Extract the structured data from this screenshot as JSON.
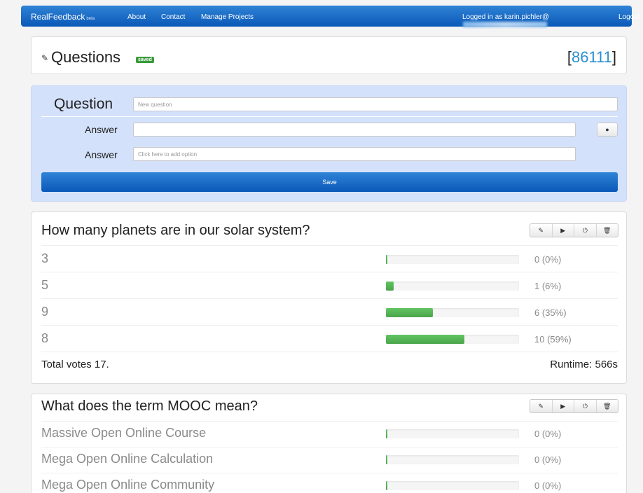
{
  "navbar": {
    "brand": "RealFeedback",
    "brand_tag": "beta",
    "links": [
      "About",
      "Contact",
      "Manage Projects"
    ],
    "logged_in_prefix": "Logged in as karin.pichler@",
    "logout": "Logout",
    "color": "#0b58b8"
  },
  "header": {
    "pencil_icon": "pencil-icon",
    "title": "Questions",
    "badge": "saved",
    "code_open": "[",
    "code": "86111",
    "code_close": "]"
  },
  "form": {
    "question_label": "Question",
    "question_placeholder": "New question",
    "question_value": "",
    "answer_label": "Answer",
    "answer1_value": "",
    "answer2_label": "Answer",
    "answer2_placeholder": "Click here to add option",
    "remove_icon": "minus-circle-icon",
    "save_label": "Save"
  },
  "questions": [
    {
      "title": "How many planets are in our solar system?",
      "toolbar": [
        "✎",
        "▶",
        "⏻",
        "🗑"
      ],
      "options": [
        {
          "label": "3",
          "count": "0 (0%)",
          "pct": 0
        },
        {
          "label": "5",
          "count": "1 (6%)",
          "pct": 6
        },
        {
          "label": "9",
          "count": "6 (35%)",
          "pct": 35
        },
        {
          "label": "8",
          "count": "10 (59%)",
          "pct": 59
        }
      ],
      "total": "Total votes 17.",
      "runtime": "Runtime: 566s"
    },
    {
      "title": "What does the term MOOC mean?",
      "toolbar": [
        "✎",
        "▶",
        "⏻",
        "🗑"
      ],
      "options": [
        {
          "label": "Massive Open Online Course",
          "count": "0 (0%)",
          "pct": 0
        },
        {
          "label": "Mega Open Online Calculation",
          "count": "0 (0%)",
          "pct": 0
        },
        {
          "label": "Mega Open Online Community",
          "count": "0 (0%)",
          "pct": 0
        }
      ]
    }
  ]
}
